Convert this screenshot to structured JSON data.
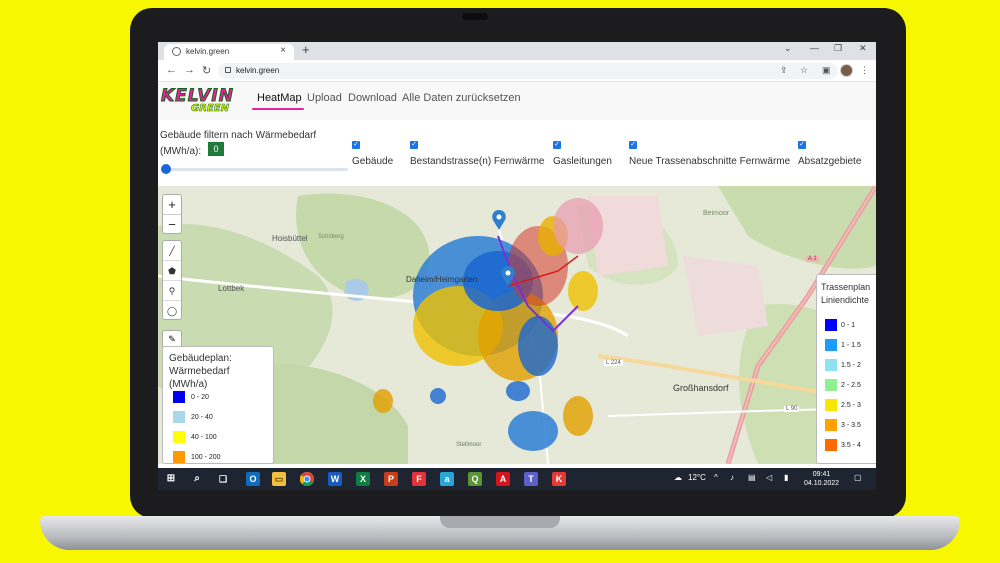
{
  "browser": {
    "tab_title": "kelvin.green",
    "url": "kelvin.green",
    "new_tab": "+",
    "close_tab": "×"
  },
  "app": {
    "logo_top": "KELVIN",
    "logo_bottom": "GREEN",
    "nav": [
      "HeatMap",
      "Upload",
      "Download",
      "Alle Daten zurücksetzen"
    ],
    "active_nav": "HeatMap"
  },
  "filter": {
    "label": "Gebäude filtern nach Wärmebedarf (MWh/a):",
    "value": "0",
    "slider_fraction": 0
  },
  "layers": [
    {
      "label": "Gebäude",
      "checked": true
    },
    {
      "label": "Bestandstrasse(n) Fernwärme",
      "checked": true
    },
    {
      "label": "Gasleitungen",
      "checked": true
    },
    {
      "label": "Neue Trassenabschnitte Fernwärme",
      "checked": true
    },
    {
      "label": "Absatzgebiete",
      "checked": true
    }
  ],
  "map": {
    "zoom_in": "+",
    "zoom_out": "−",
    "places": [
      "Hoisbüttel",
      "Lottbek",
      "Daheim/Heimgarten",
      "Großhansdorf",
      "Beimoor",
      "A 1",
      "L 224",
      "L 90",
      "Schüberg",
      "Stellmoor"
    ]
  },
  "legend_buildings": {
    "title": "Gebäudeplan: Wärmebedarf (MWh/a)",
    "items": [
      {
        "label": "0 - 20",
        "color": "#0000ee"
      },
      {
        "label": "20 - 40",
        "color": "#a9d6e8"
      },
      {
        "label": "40 - 100",
        "color": "#ffff00"
      },
      {
        "label": "100 - 200",
        "color": "#ff9900"
      }
    ]
  },
  "legend_trassen": {
    "title": "Trassenplan Liniendichte",
    "items": [
      {
        "label": "0 - 1",
        "color": "#0000ff"
      },
      {
        "label": "1 - 1.5",
        "color": "#1e9bff"
      },
      {
        "label": "1.5 - 2",
        "color": "#8fe3f0"
      },
      {
        "label": "2 - 2.5",
        "color": "#8ff08f"
      },
      {
        "label": "2.5 - 3",
        "color": "#f6e600"
      },
      {
        "label": "3 - 3.5",
        "color": "#ffa200"
      },
      {
        "label": "3.5 - 4",
        "color": "#ff6a00"
      }
    ]
  },
  "taskbar": {
    "weather": "12°C",
    "time": "09:41",
    "date": "04.10.2022"
  }
}
